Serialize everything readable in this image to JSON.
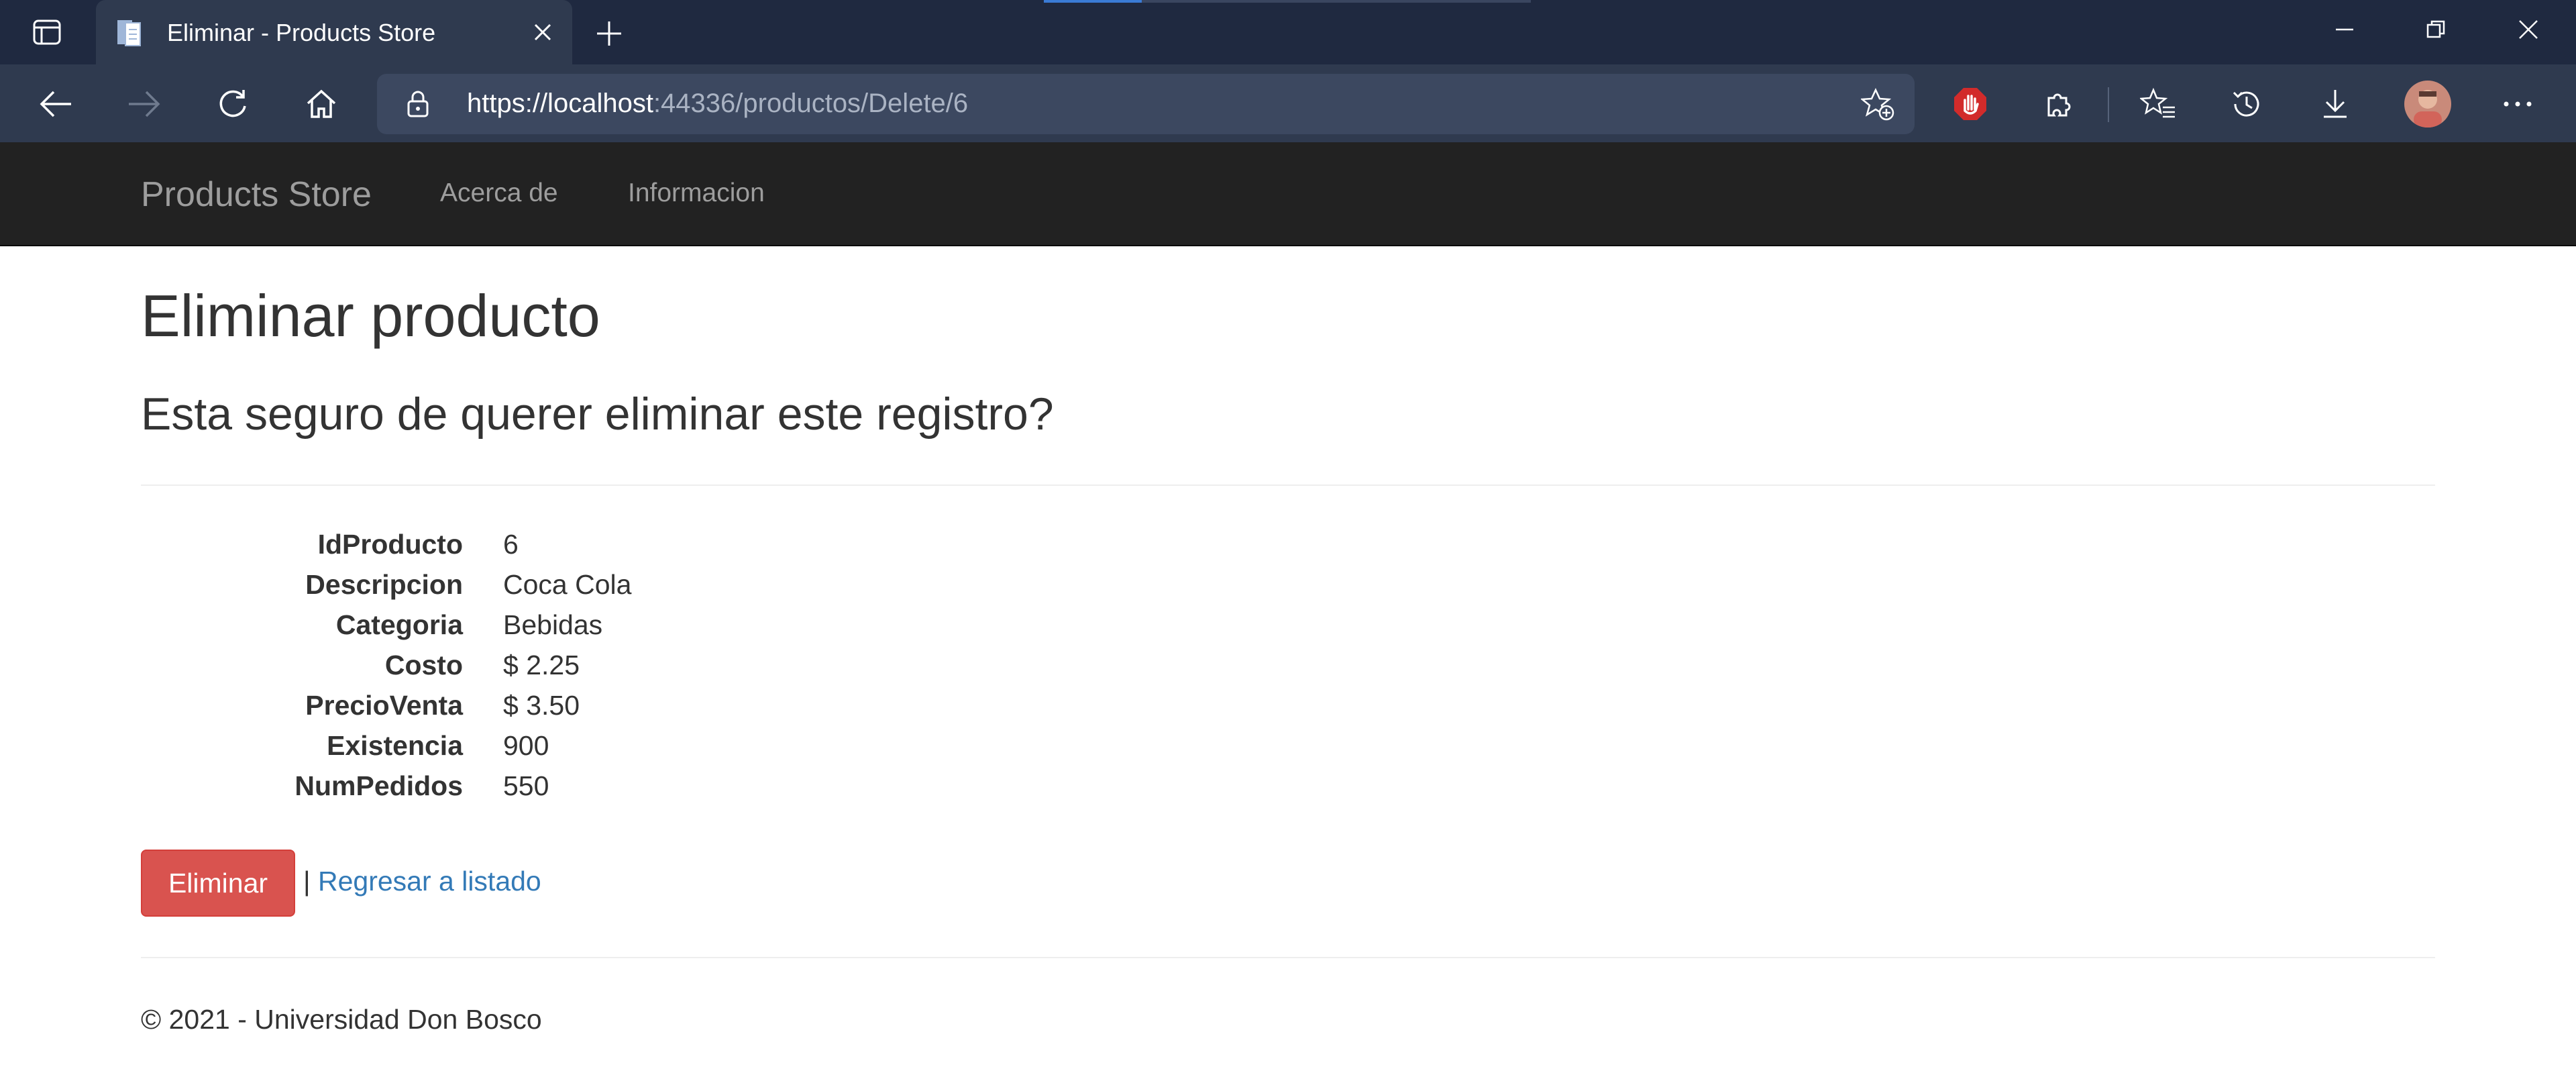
{
  "browser": {
    "tab_title": "Eliminar - Products Store",
    "url_host": "https://localhost",
    "url_rest": ":44336/productos/Delete/6"
  },
  "navbar": {
    "brand": "Products Store",
    "links": [
      "Acerca de",
      "Informacion"
    ]
  },
  "page": {
    "title": "Eliminar producto",
    "question": "Esta seguro de querer eliminar este registro?"
  },
  "details": [
    {
      "label": "IdProducto",
      "value": "6"
    },
    {
      "label": "Descripcion",
      "value": "Coca Cola"
    },
    {
      "label": "Categoria",
      "value": "Bebidas"
    },
    {
      "label": "Costo",
      "value": "$ 2.25"
    },
    {
      "label": "PrecioVenta",
      "value": "$ 3.50"
    },
    {
      "label": "Existencia",
      "value": "900"
    },
    {
      "label": "NumPedidos",
      "value": "550"
    }
  ],
  "actions": {
    "delete_label": "Eliminar",
    "separator": "|",
    "back_label": "Regresar a listado"
  },
  "footer": {
    "text": "© 2021 - Universidad Don Bosco"
  },
  "colors": {
    "danger": "#d9534f",
    "link": "#337ab7",
    "navbar": "#222222"
  }
}
